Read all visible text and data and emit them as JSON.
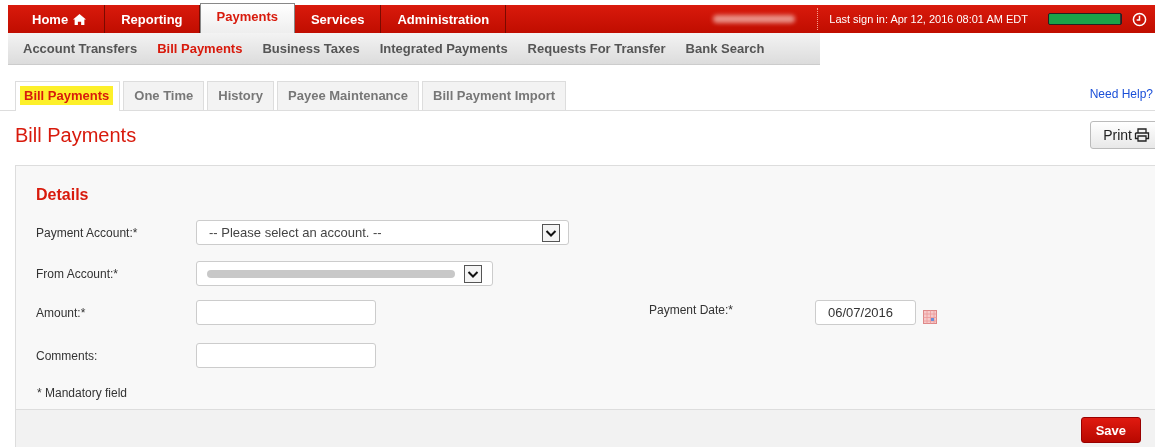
{
  "top_nav": [
    {
      "label": "Home",
      "selected": false,
      "kind": "home"
    },
    {
      "label": "Reporting",
      "selected": false,
      "kind": "plain"
    },
    {
      "label": "Payments",
      "selected": true,
      "kind": "plain"
    },
    {
      "label": "Services",
      "selected": false,
      "kind": "plain"
    },
    {
      "label": "Administration",
      "selected": false,
      "kind": "plain"
    }
  ],
  "last_sign_in": "Last sign in: Apr 12, 2016 08:01 AM EDT",
  "session_meter": {
    "level": 0.98
  },
  "sub_nav": [
    {
      "label": "Account Transfers",
      "selected": false
    },
    {
      "label": "Bill Payments",
      "selected": true
    },
    {
      "label": "Business Taxes",
      "selected": false
    },
    {
      "label": "Integrated Payments",
      "selected": false
    },
    {
      "label": "Requests For Transfer",
      "selected": false
    },
    {
      "label": "Bank Search",
      "selected": false
    }
  ],
  "tabs": [
    {
      "label": "Bill Payments",
      "selected": true
    },
    {
      "label": "One Time",
      "selected": false
    },
    {
      "label": "History",
      "selected": false
    },
    {
      "label": "Payee Maintenance",
      "selected": false
    },
    {
      "label": "Bill Payment Import",
      "selected": false
    }
  ],
  "help_link": "Need Help?",
  "page_title": "Bill Payments",
  "print_button": "Print",
  "details": {
    "heading": "Details",
    "payment_account": {
      "label": "Payment Account:*",
      "value": "-- Please select an account. --"
    },
    "from_account": {
      "label": "From Account:*"
    },
    "amount": {
      "label": "Amount:*"
    },
    "payment_date": {
      "label": "Payment Date:*",
      "value": "06/07/2016"
    },
    "comments": {
      "label": "Comments:"
    },
    "note": "* Mandatory field"
  },
  "save_button": "Save"
}
